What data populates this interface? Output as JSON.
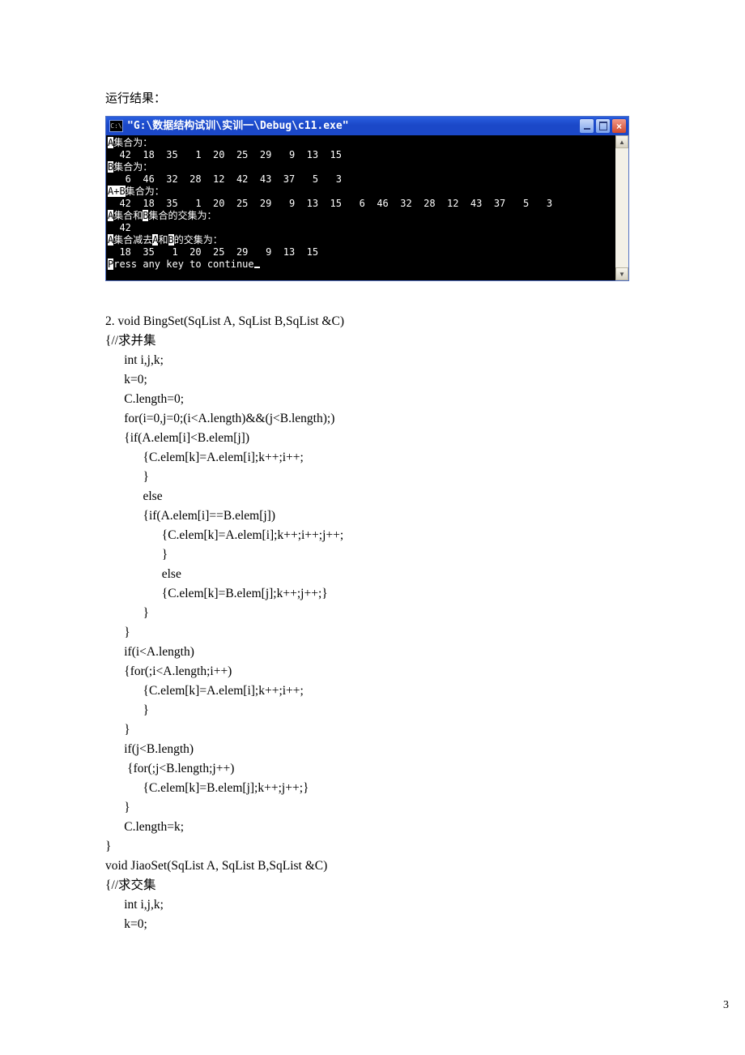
{
  "caption": "运行结果：",
  "console": {
    "icon_label": "C:\\",
    "title": "\"G:\\数据结构试训\\实训一\\Debug\\c11.exe\"",
    "lines": {
      "l1a": "A",
      "l1b": "集合为：",
      "l2": "  42  18  35   1  20  25  29   9  13  15",
      "l3a": "B",
      "l3b": "集合为：",
      "l4": "   6  46  32  28  12  42  43  37   5   3",
      "l5a": "A+B",
      "l5b": "集合为：",
      "l6": "  42  18  35   1  20  25  29   9  13  15   6  46  32  28  12  43  37   5   3",
      "l7a": "A",
      "l7b": "集合和",
      "l7c": "B",
      "l7d": "集合的交集为：",
      "l8": "  42",
      "l9a": "A",
      "l9b": "集合减去",
      "l9c": "A",
      "l9d": "和",
      "l9e": "B",
      "l9f": "的交集为：",
      "l10": "  18  35   1  20  25  29   9  13  15",
      "l11a": "P",
      "l11b": "ress any key to continue"
    }
  },
  "code": "2. void BingSet(SqList A, SqList B,SqList &C)\n{//求并集\n      int i,j,k;\n      k=0;\n      C.length=0;\n      for(i=0,j=0;(i<A.length)&&(j<B.length);)\n      {if(A.elem[i]<B.elem[j])\n            {C.elem[k]=A.elem[i];k++;i++;\n            }\n            else\n            {if(A.elem[i]==B.elem[j])\n                  {C.elem[k]=A.elem[i];k++;i++;j++;\n                  }\n                  else\n                  {C.elem[k]=B.elem[j];k++;j++;}\n            }\n      }\n      if(i<A.length)\n      {for(;i<A.length;i++)\n            {C.elem[k]=A.elem[i];k++;i++;\n            }\n      }\n      if(j<B.length)\n       {for(;j<B.length;j++)\n            {C.elem[k]=B.elem[j];k++;j++;}\n      }\n      C.length=k;\n}\nvoid JiaoSet(SqList A, SqList B,SqList &C)\n{//求交集\n      int i,j,k;\n      k=0;",
  "page_number": "3"
}
